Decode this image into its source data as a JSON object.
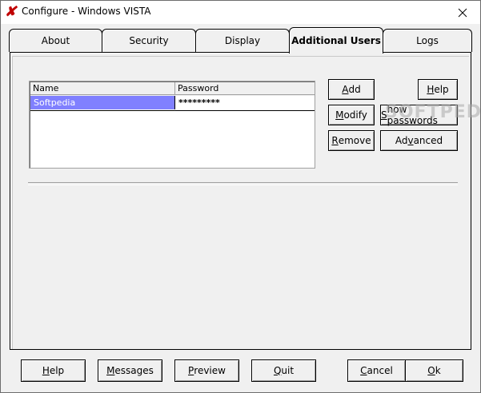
{
  "window": {
    "title": "Configure - Windows VISTA",
    "app_icon": "x-app-icon",
    "close_icon": "close-icon"
  },
  "tabs": [
    {
      "label": "About",
      "active": false
    },
    {
      "label": "Security",
      "active": false
    },
    {
      "label": "Display",
      "active": false
    },
    {
      "label": "Additional Users",
      "active": true
    },
    {
      "label": "Logs",
      "active": false
    }
  ],
  "users_list": {
    "columns": [
      "Name",
      "Password"
    ],
    "rows": [
      {
        "name": "Softpedia",
        "password": "*********",
        "selected": true
      }
    ]
  },
  "panel_buttons": {
    "add": {
      "pre": "",
      "mn": "A",
      "post": "dd"
    },
    "help": {
      "pre": "",
      "mn": "H",
      "post": "elp"
    },
    "modify": {
      "pre": "",
      "mn": "M",
      "post": "odify"
    },
    "show_passwords": {
      "pre": "",
      "mn": "S",
      "post": "how passwords"
    },
    "remove": {
      "pre": "",
      "mn": "R",
      "post": "emove"
    },
    "advanced": {
      "pre": "Ad",
      "mn": "v",
      "post": "anced"
    }
  },
  "bottom_buttons": {
    "help": {
      "pre": "",
      "mn": "H",
      "post": "elp"
    },
    "messages": {
      "pre": "",
      "mn": "M",
      "post": "essages"
    },
    "preview": {
      "pre": "",
      "mn": "P",
      "post": "review"
    },
    "quit": {
      "pre": "",
      "mn": "Q",
      "post": "uit"
    },
    "cancel": {
      "pre": "",
      "mn": "C",
      "post": "ancel"
    },
    "ok": {
      "pre": "",
      "mn": "O",
      "post": "k"
    }
  },
  "watermark": "SOFTPEDIA",
  "colors": {
    "selection": "#8080ff",
    "app_icon": "#c00000"
  }
}
